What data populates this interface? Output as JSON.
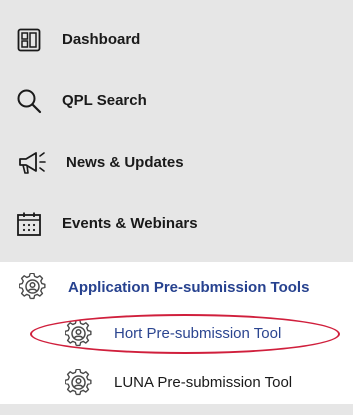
{
  "nav": {
    "items": [
      {
        "label": "Dashboard",
        "icon": "dashboard-icon"
      },
      {
        "label": "QPL Search",
        "icon": "search-icon"
      },
      {
        "label": "News & Updates",
        "icon": "megaphone-icon"
      },
      {
        "label": "Events & Webinars",
        "icon": "calendar-icon"
      }
    ]
  },
  "tools": {
    "section_label": "Application Pre-submission Tools",
    "section_icon": "gear-icon",
    "items": [
      {
        "label": "Hort Pre-submission Tool",
        "icon": "gear-icon",
        "highlighted": true
      },
      {
        "label": "LUNA Pre-submission Tool",
        "icon": "gear-icon",
        "highlighted": false
      }
    ]
  },
  "colors": {
    "nav_background": "#e6e6e6",
    "link_blue": "#27428f",
    "highlight_red": "#d01f3c"
  }
}
